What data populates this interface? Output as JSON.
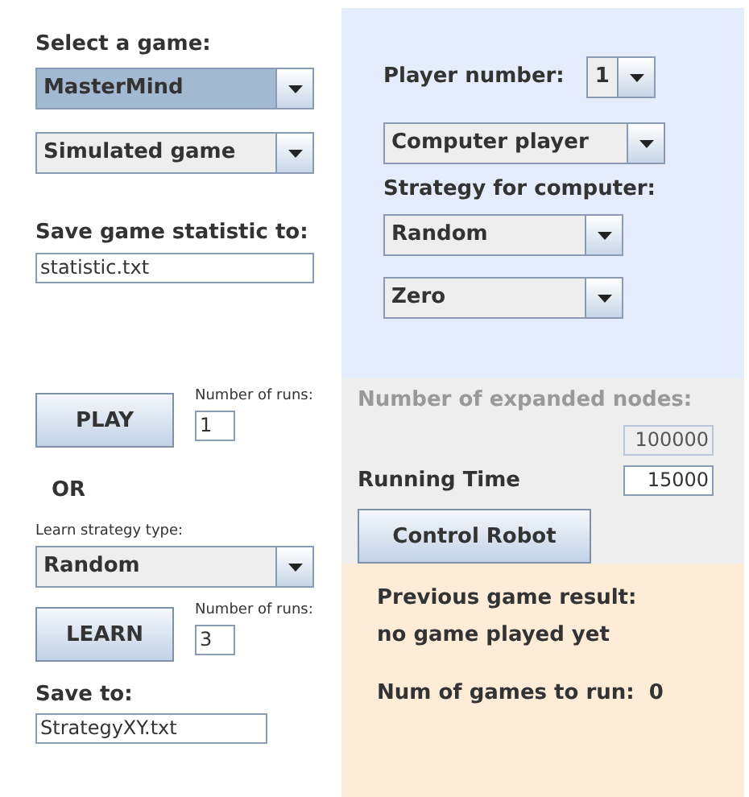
{
  "game_panel": {
    "title": "Select a game:",
    "game_combo": {
      "value": "MasterMind",
      "focused": true
    },
    "mode_combo": {
      "value": "Simulated game",
      "focused": false
    },
    "statistic_label": "Save game statistic to:",
    "statistic_field": "statistic.txt",
    "play_button": "PLAY",
    "play_runs_label": "Number of runs:",
    "play_runs": "1",
    "or_label": "OR",
    "learn_type_label": "Learn strategy type:",
    "learn_combo": {
      "value": "Random",
      "focused": false
    },
    "learn_button": "LEARN",
    "learn_runs_label": "Number of runs:",
    "learn_runs": "3",
    "save_label": "Save to:",
    "save_field": "StrategyXY.txt"
  },
  "player_panel": {
    "player_label": "Player number:",
    "player_combo": {
      "value": "1",
      "focused": false
    },
    "type_combo": {
      "value": "Computer player",
      "focused": false
    },
    "strategy_label": "Strategy for computer:",
    "strategy_combo": {
      "value": "Random",
      "focused": false
    },
    "second_combo": {
      "value": "Zero",
      "focused": false
    }
  },
  "robot_panel": {
    "nodes_label": "Number of expanded nodes:",
    "nodes_value": "100000",
    "nodes_disabled": true,
    "time_label": "Running Time",
    "time_value": "15000",
    "robot_button": "Control Robot"
  },
  "result_panel": {
    "title": "Previous game result:",
    "result": "no game played yet",
    "runs_label": "Num of games to run:",
    "runs_value": "0"
  }
}
